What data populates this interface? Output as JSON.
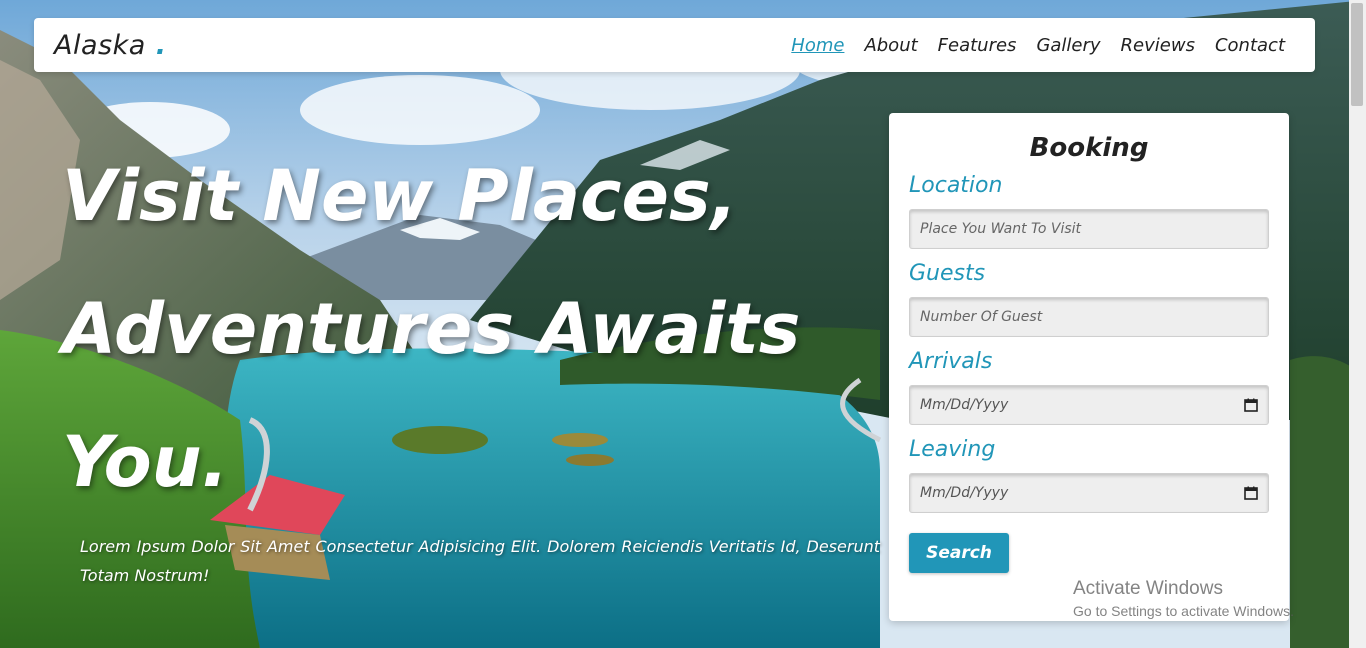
{
  "navbar": {
    "logo": "Alaska",
    "logo_dot": ".",
    "links": [
      {
        "label": "Home",
        "active": true
      },
      {
        "label": "About",
        "active": false
      },
      {
        "label": "Features",
        "active": false
      },
      {
        "label": "Gallery",
        "active": false
      },
      {
        "label": "Reviews",
        "active": false
      },
      {
        "label": "Contact",
        "active": false
      }
    ]
  },
  "hero": {
    "line1": "Visit New Places,",
    "line2": "Adventures Awaits",
    "line3": "You.",
    "description": "Lorem Ipsum Dolor Sit Amet Consectetur Adipisicing Elit. Dolorem Reiciendis Veritatis Id, Deserunt Totam Nostrum!"
  },
  "booking": {
    "title": "Booking",
    "location_label": "Location",
    "location_placeholder": "Place You Want To Visit",
    "guests_label": "Guests",
    "guests_placeholder": "Number Of Guest",
    "arrivals_label": "Arrivals",
    "arrivals_value": "Mm/Dd/Yyyy",
    "leaving_label": "Leaving",
    "leaving_value": "Mm/Dd/Yyyy",
    "search_label": "Search"
  },
  "watermark": {
    "title": "Activate Windows",
    "subtitle": "Go to Settings to activate Windows."
  },
  "colors": {
    "accent": "#2196b8",
    "text_dark": "#222222",
    "hero_text": "#ffffff"
  }
}
